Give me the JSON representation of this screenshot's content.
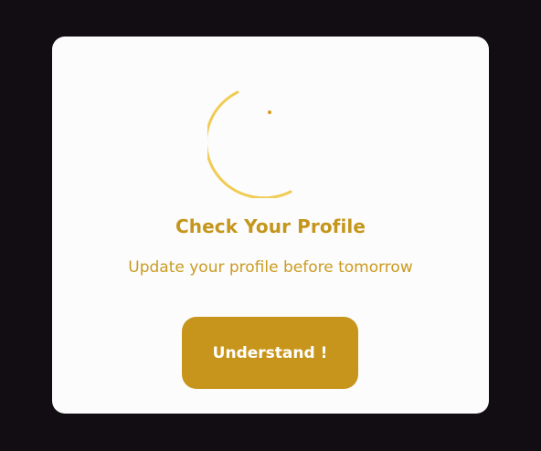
{
  "dialog": {
    "title": "Check Your Profile",
    "message": "Update your profile before tomorrow",
    "button_label": "Understand !",
    "icon": "loading-spinner-icon"
  },
  "colors": {
    "backdrop": "#110d12",
    "card": "#fcfcfd",
    "accent": "#c8951c",
    "spinner": "#f0cc55"
  }
}
